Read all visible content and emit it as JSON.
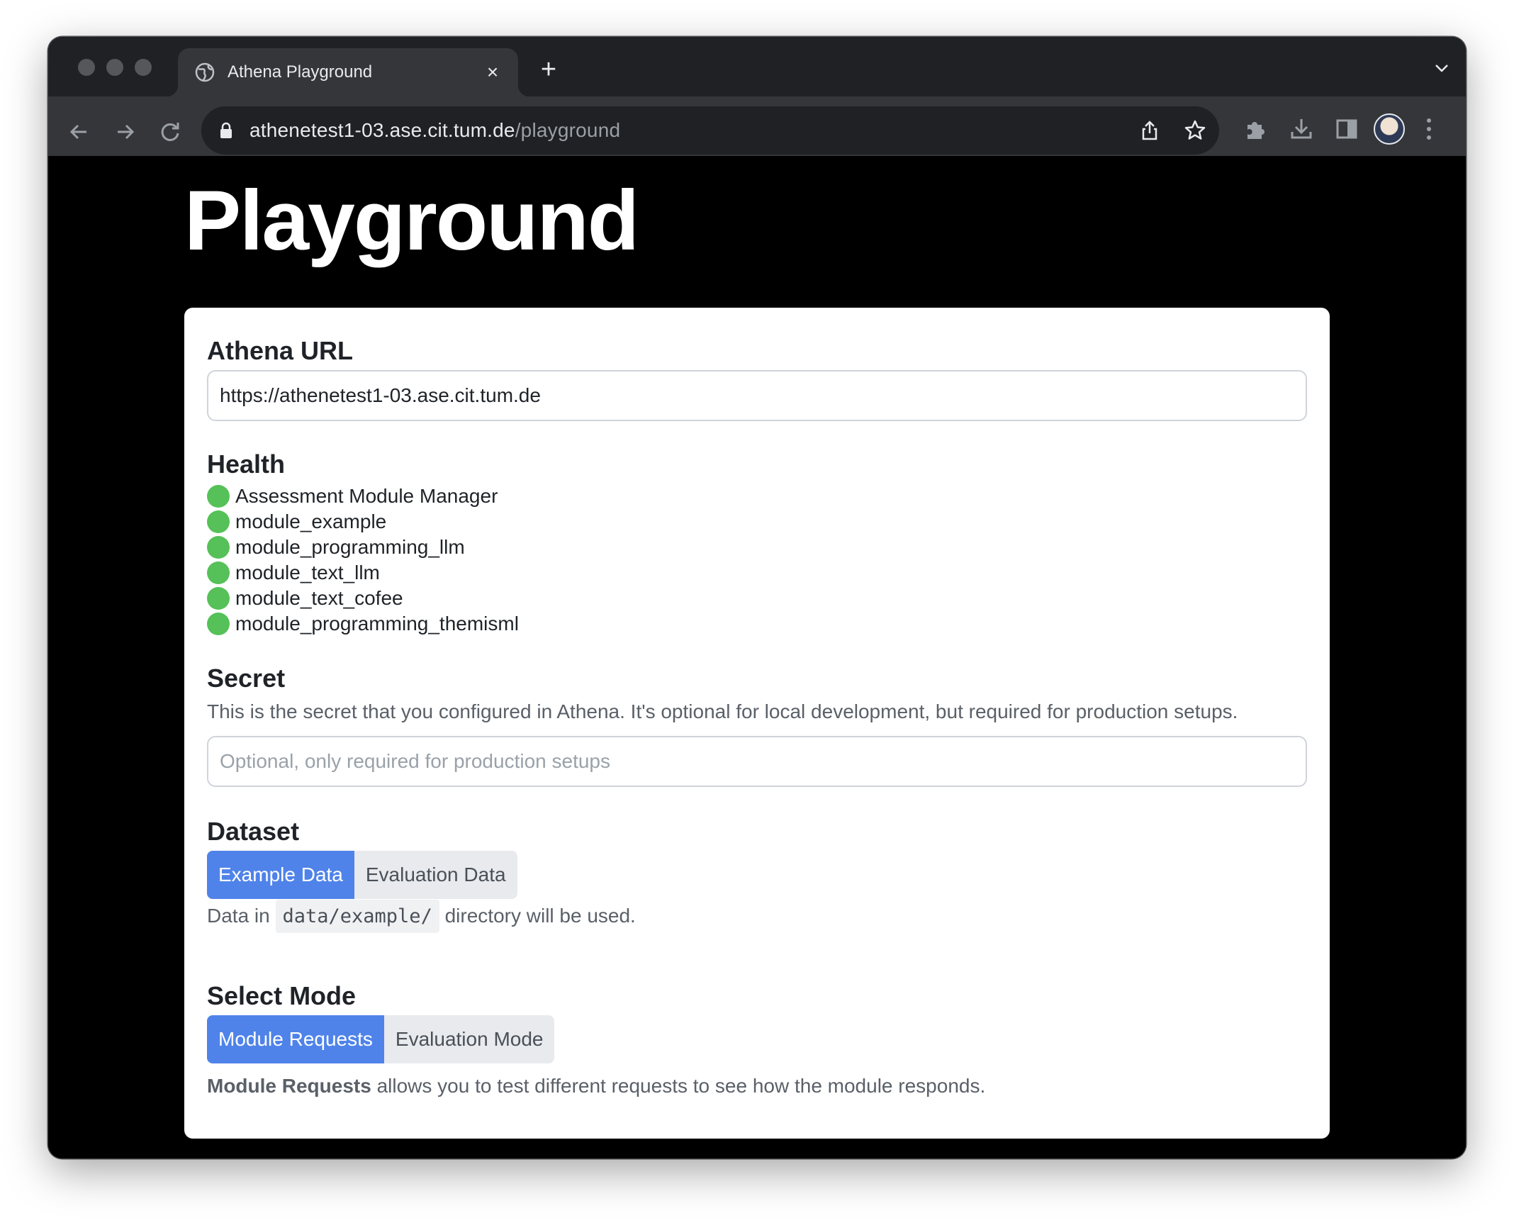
{
  "browser": {
    "tab_title": "Athena Playground",
    "url_host": "athenetest1-03.ase.cit.tum.de",
    "url_path": "/playground",
    "tab_close_glyph": "×",
    "new_tab_glyph": "+"
  },
  "page": {
    "title": "Playground"
  },
  "athena_url": {
    "heading": "Athena URL",
    "value": "https://athenetest1-03.ase.cit.tum.de"
  },
  "health": {
    "heading": "Health",
    "status_color": "#55c158",
    "items": [
      {
        "label": "Assessment Module Manager",
        "status": "healthy"
      },
      {
        "label": "module_example",
        "status": "healthy"
      },
      {
        "label": "module_programming_llm",
        "status": "healthy"
      },
      {
        "label": "module_text_llm",
        "status": "healthy"
      },
      {
        "label": "module_text_cofee",
        "status": "healthy"
      },
      {
        "label": "module_programming_themisml",
        "status": "healthy"
      }
    ]
  },
  "secret": {
    "heading": "Secret",
    "description": "This is the secret that you configured in Athena. It's optional for local development, but required for production setups.",
    "value": "",
    "placeholder": "Optional, only required for production setups"
  },
  "dataset": {
    "heading": "Dataset",
    "options": [
      "Example Data",
      "Evaluation Data"
    ],
    "selected": "Example Data",
    "note_prefix": "Data in",
    "note_code": "data/example/",
    "note_suffix": "directory will be used."
  },
  "mode": {
    "heading": "Select Mode",
    "options": [
      "Module Requests",
      "Evaluation Mode"
    ],
    "selected": "Module Requests",
    "note_bold": "Module Requests",
    "note_rest": "allows you to test different requests to see how the module responds."
  },
  "colors": {
    "accent": "#4f83e9",
    "page_background": "#000000"
  }
}
